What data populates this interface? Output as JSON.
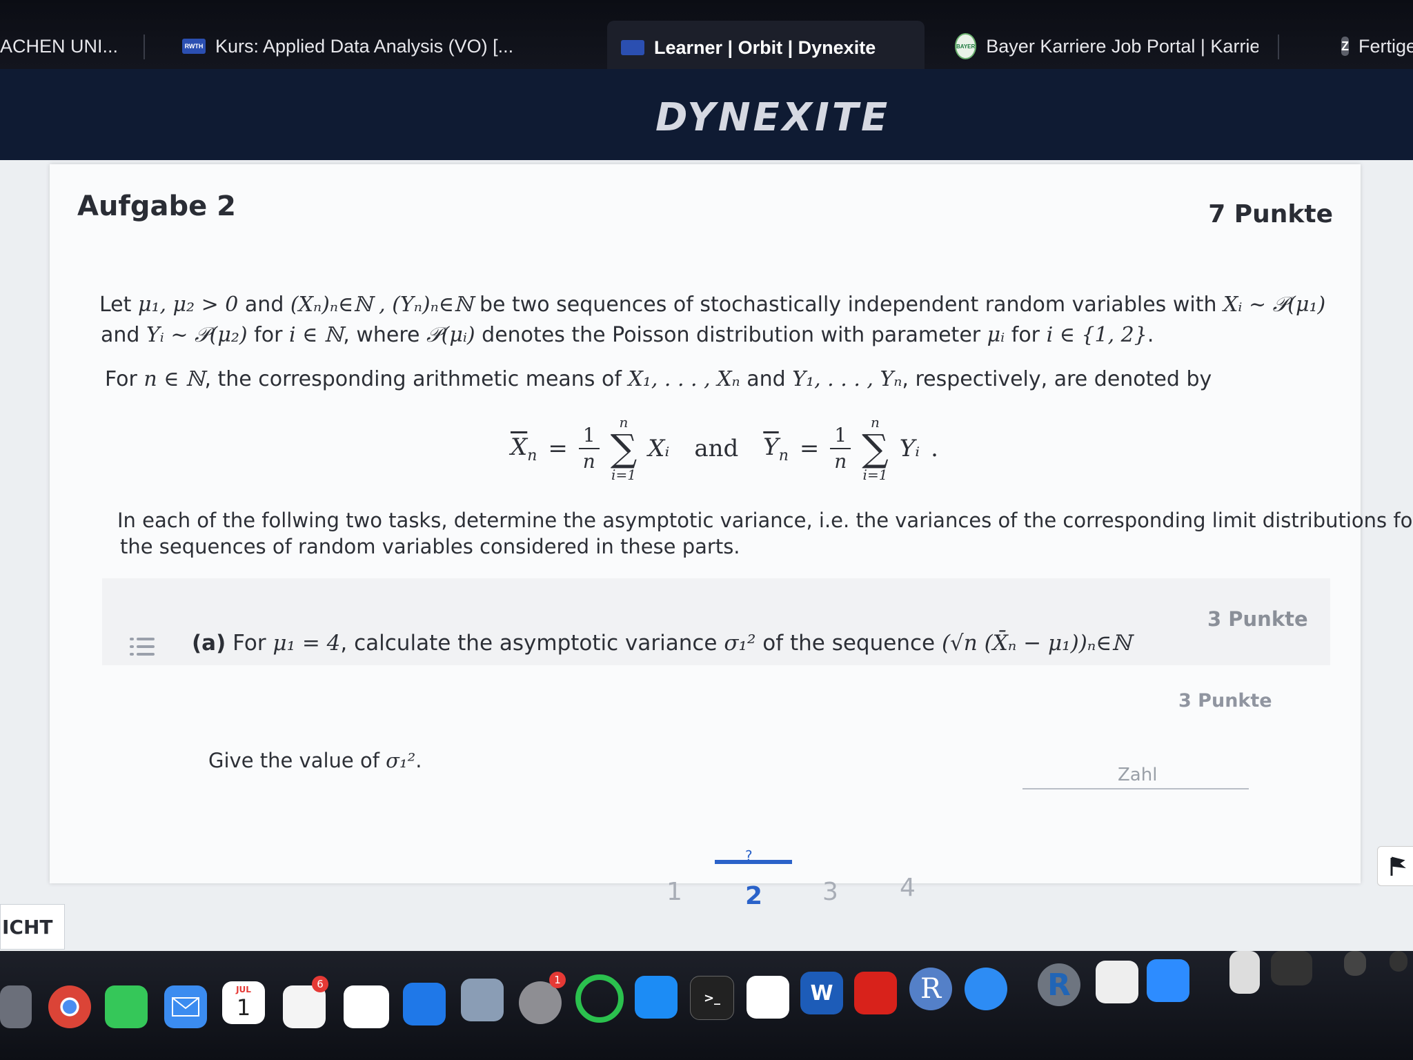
{
  "browser": {
    "tabs": [
      {
        "label": "ACHEN UNI..."
      },
      {
        "label": "Kurs: Applied Data Analysis (VO) [..."
      },
      {
        "label": "Learner | Orbit | Dynexite"
      },
      {
        "label": "Bayer Karriere Job Portal | Karriere..."
      },
      {
        "label": "Fertige"
      }
    ],
    "favicons": {
      "rwth": "RWTH",
      "bayer": "BAYER",
      "z": "Z"
    }
  },
  "header": {
    "logo": "DYNEXITE"
  },
  "task": {
    "title": "Aufgabe 2",
    "points": "7 Punkte",
    "intro1_a": "Let",
    "intro1_m1": "μ₁, μ₂ > 0",
    "intro1_b": "and",
    "intro1_m2": "(Xₙ)ₙ∈ℕ , (Yₙ)ₙ∈ℕ",
    "intro1_c": "be two sequences of stochastically independent random variables with",
    "intro1_m3": "Xᵢ ~ 𝒫(μ₁)",
    "intro2_a": "and",
    "intro2_m1": "Yᵢ ~ 𝒫(μ₂)",
    "intro2_b": "for",
    "intro2_m2": "i ∈ ℕ",
    "intro2_c": ", where",
    "intro2_m3": "𝒫(μᵢ)",
    "intro2_d": "denotes the Poisson distribution with parameter",
    "intro2_m4": "μᵢ",
    "intro2_e": "for",
    "intro2_m5": "i ∈ {1, 2}",
    "intro2_f": ".",
    "means_a": "For",
    "means_m1": "n ∈ ℕ",
    "means_b": ", the corresponding arithmetic means of",
    "means_m2": "X₁, . . . , Xₙ",
    "means_c": "and",
    "means_m3": "Y₁, . . . , Yₙ",
    "means_d": ", respectively, are denoted by",
    "formula": {
      "xbar": "X",
      "xbar_sub": "n",
      "eq": "=",
      "one": "1",
      "n": "n",
      "sum_top": "n",
      "sigma": "∑",
      "sum_bottom": "i=1",
      "xi": "Xᵢ",
      "and": "and",
      "ybar": "Y",
      "ybar_sub": "n",
      "yi": "Yᵢ",
      "dot": "."
    },
    "instr1": "In each of the follwing two tasks, determine the asymptotic variance, i.e. the variances of the corresponding limit distributions for",
    "instr2": "the sequences of random variables considered in these parts.",
    "part_a": {
      "label": "(a)",
      "text_a": "For",
      "m1": "μ₁ = 4",
      "text_b": ", calculate the asymptotic variance",
      "m2": "σ₁²",
      "text_c": "of the sequence",
      "m3": "(√n (X̄ₙ − μ₁))ₙ∈ℕ",
      "points": "3 Punkte",
      "sub_points": "3 Punkte",
      "question_a": "Give the value of",
      "question_m": "σ₁²",
      "question_b": ".",
      "input_placeholder": "Zahl"
    }
  },
  "pager": {
    "mark": "?",
    "pages": [
      "1",
      "2",
      "3",
      "4"
    ],
    "current": "2"
  },
  "left_button": "ICHT",
  "dock": {
    "calendar_month": "JUL",
    "calendar_day": "1",
    "reminders_badge": "6",
    "settings_badge": "1",
    "r_label": "R",
    "word_label": "W",
    "term_label": ">_"
  },
  "colors": {
    "accent": "#2a62c9",
    "header": "#0f1b33",
    "card": "#fafbfc"
  }
}
